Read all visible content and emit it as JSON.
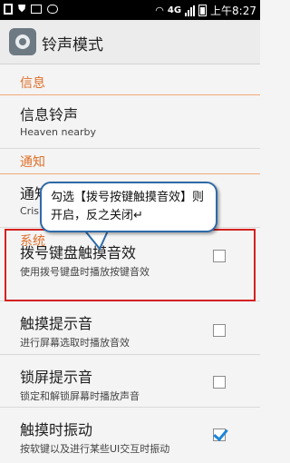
{
  "status_bar": {
    "network": "4G",
    "time": "上午8:27"
  },
  "action_bar": {
    "title": "铃声模式",
    "icon": "settings-icon"
  },
  "sections": {
    "info": "信息",
    "notify": "通知",
    "system": "系统"
  },
  "items": {
    "msg_ringtone": {
      "title": "信息铃声",
      "subtitle": "Heaven nearby"
    },
    "notify_item": {
      "title": "通知",
      "subtitle": "Cris"
    },
    "keypad_tone": {
      "title": "拨号键盘触摸音效",
      "subtitle": "使用拨号键盘时播放按键音效",
      "checked": false
    },
    "touch_sound": {
      "title": "触摸提示音",
      "subtitle": "进行屏幕选取时播放音效",
      "checked": false
    },
    "lock_sound": {
      "title": "锁屏提示音",
      "subtitle": "锁定和解锁屏幕时播放声音",
      "checked": false
    },
    "vibrate": {
      "title": "触摸时振动",
      "subtitle": "按软键以及进行某些UI交互时振动",
      "checked": true
    }
  },
  "callout": {
    "text": "勾选【拨号按键触摸音效】则开启，反之关闭↵"
  },
  "colors": {
    "accent": "#e0702a",
    "check": "#1f86d6",
    "highlight": "#d42020",
    "callout_border": "#2e6aa8"
  }
}
